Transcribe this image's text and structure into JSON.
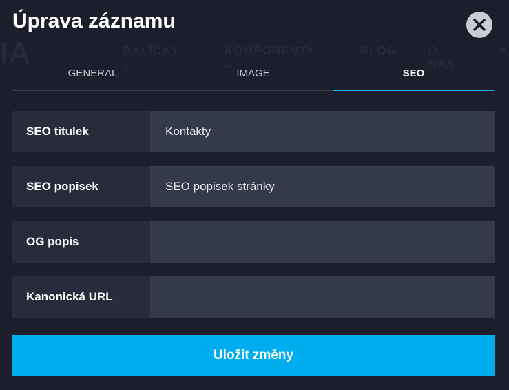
{
  "background_nav": {
    "logo": "IA",
    "items": [
      "BALÍČKY ⌄",
      "KOMPONENTY ⌄",
      "BLOG",
      "O NÁS",
      "K"
    ]
  },
  "modal": {
    "title": "Úprava záznamu",
    "close_icon": "close-icon"
  },
  "tabs": [
    {
      "label": "GENERAL",
      "active": false
    },
    {
      "label": "IMAGE",
      "active": false
    },
    {
      "label": "SEO",
      "active": true
    }
  ],
  "fields": [
    {
      "label": "SEO titulek",
      "value": "Kontakty"
    },
    {
      "label": "SEO popisek",
      "value": "SEO popisek stránky"
    },
    {
      "label": "OG popis",
      "value": ""
    },
    {
      "label": "Kanonická URL",
      "value": ""
    }
  ],
  "save_label": "Uložit změny",
  "colors": {
    "background": "#1c1f2b",
    "accent": "#00adef",
    "label_bg": "#272b3a",
    "input_bg": "#353a4b"
  }
}
